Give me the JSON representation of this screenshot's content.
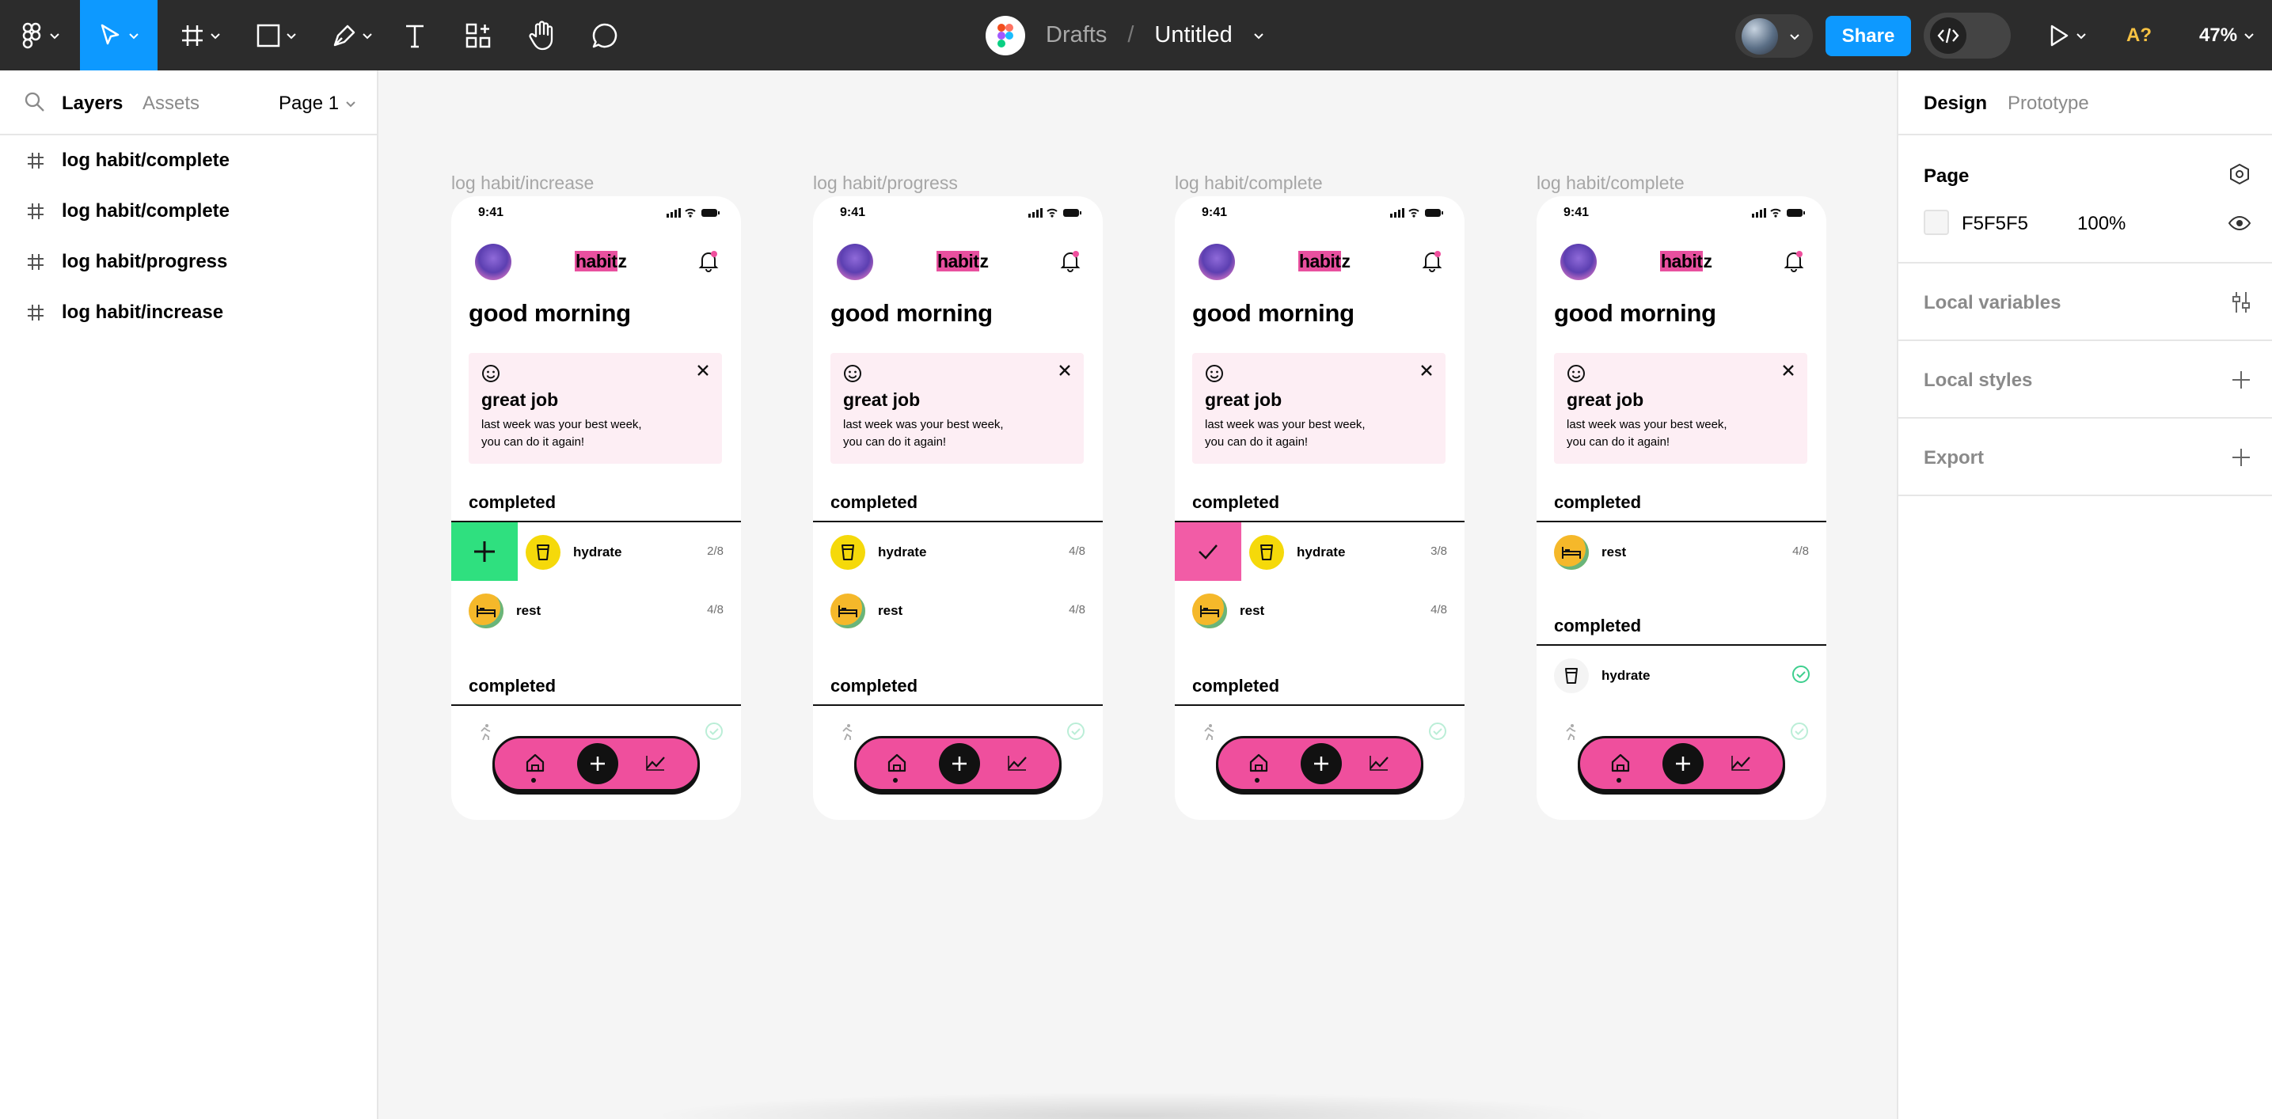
{
  "toolbar": {
    "breadcrumb_drafts": "Drafts",
    "breadcrumb_sep": "/",
    "file_title": "Untitled",
    "share_label": "Share",
    "aa_label": "A?",
    "zoom": "47%",
    "accent": "#0d99ff"
  },
  "left_panel": {
    "tab_layers": "Layers",
    "tab_assets": "Assets",
    "page_select": "Page 1",
    "layers": [
      "log habit/complete",
      "log habit/complete",
      "log habit/progress",
      "log habit/increase"
    ]
  },
  "right_panel": {
    "tab_design": "Design",
    "tab_prototype": "Prototype",
    "page_title": "Page",
    "page_color": "F5F5F5",
    "page_opacity": "100%",
    "local_variables": "Local variables",
    "local_styles": "Local styles",
    "export": "Export"
  },
  "frames": [
    {
      "label": "log habit/increase",
      "time": "9:41",
      "logo_hl": "habit",
      "logo_rest": "z",
      "greeting": "good morning",
      "card_title": "great job",
      "card_line1": "last week was your best week,",
      "card_line2": "you can do it again!",
      "section1": "completed",
      "rows": [
        {
          "name": "hydrate",
          "count": "2/8",
          "icon": "cup-icon",
          "swipe": "plus"
        },
        {
          "name": "rest",
          "count": "4/8",
          "icon": "bed-icon"
        }
      ],
      "section2": "completed"
    },
    {
      "label": "log habit/progress",
      "time": "9:41",
      "logo_hl": "habit",
      "logo_rest": "z",
      "greeting": "good morning",
      "card_title": "great job",
      "card_line1": "last week was your best week,",
      "card_line2": "you can do it again!",
      "section1": "completed",
      "rows": [
        {
          "name": "hydrate",
          "count": "4/8",
          "icon": "cup-icon"
        },
        {
          "name": "rest",
          "count": "4/8",
          "icon": "bed-icon"
        }
      ],
      "section2": "completed"
    },
    {
      "label": "log habit/complete",
      "time": "9:41",
      "logo_hl": "habit",
      "logo_rest": "z",
      "greeting": "good morning",
      "card_title": "great job",
      "card_line1": "last week was your best week,",
      "card_line2": "you can do it again!",
      "section1": "completed",
      "rows": [
        {
          "name": "hydrate",
          "count": "3/8",
          "icon": "cup-icon",
          "swipe": "check"
        },
        {
          "name": "rest",
          "count": "4/8",
          "icon": "bed-icon"
        }
      ],
      "section2": "completed"
    },
    {
      "label": "log habit/complete",
      "time": "9:41",
      "logo_hl": "habit",
      "logo_rest": "z",
      "greeting": "good morning",
      "card_title": "great job",
      "card_line1": "last week was your best week,",
      "card_line2": "you can do it again!",
      "section1": "completed",
      "rows": [
        {
          "name": "rest",
          "count": "4/8",
          "icon": "bed-icon"
        }
      ],
      "section2": "completed",
      "completed_rows": [
        {
          "name": "hydrate",
          "icon": "cup-icon"
        }
      ]
    }
  ],
  "colors": {
    "nav_pink": "#ef4f9d",
    "swipe_green": "#2fe07f",
    "swipe_pink": "#f25ca6",
    "card_bg": "#fdeef4",
    "check_green": "#3ecf8e"
  }
}
